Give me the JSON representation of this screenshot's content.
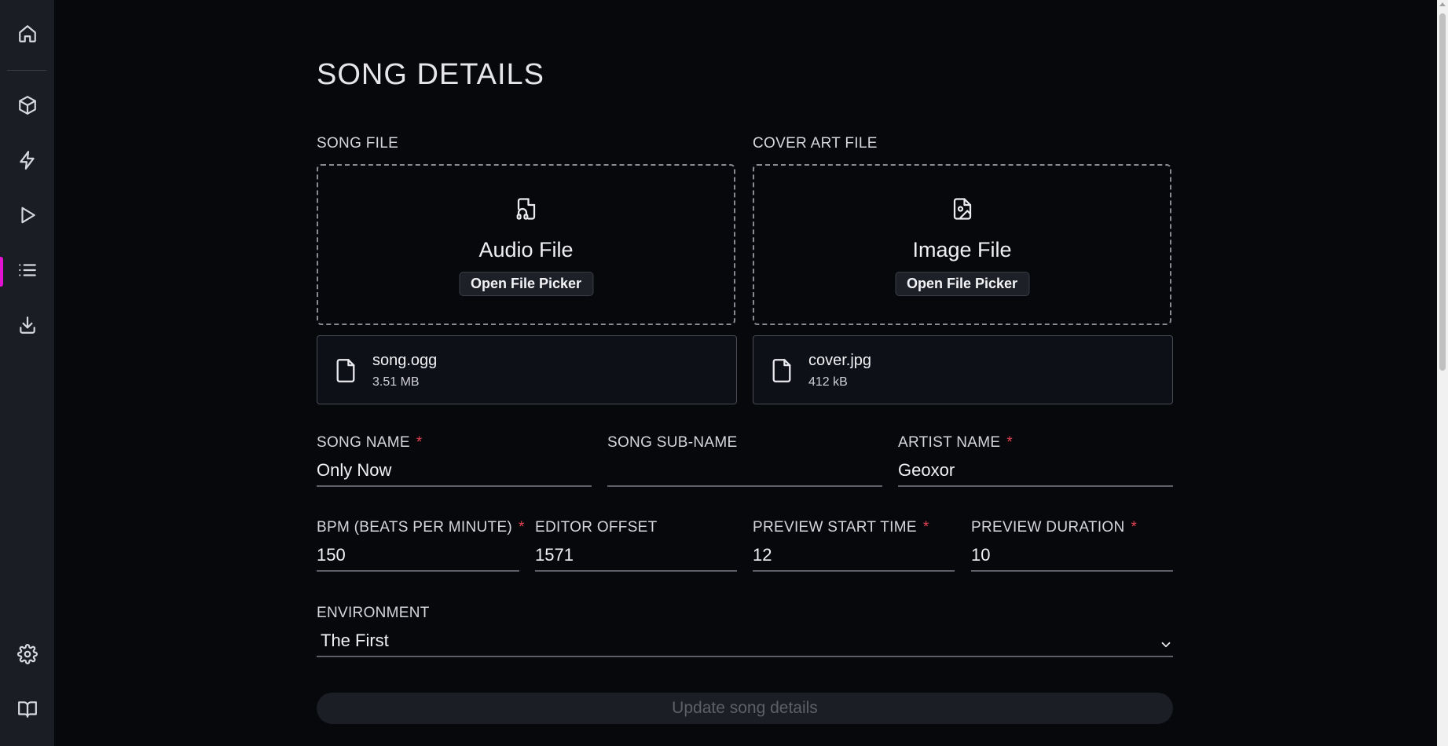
{
  "sidebar": {
    "items": [
      {
        "icon": "home-icon"
      },
      {
        "icon": "cube-icon"
      },
      {
        "icon": "lightning-icon"
      },
      {
        "icon": "play-icon"
      },
      {
        "icon": "list-icon",
        "active": true
      },
      {
        "icon": "download-icon"
      },
      {
        "icon": "settings-icon"
      },
      {
        "icon": "book-icon"
      }
    ],
    "accent_color": "#e112d0"
  },
  "page": {
    "title": "SONG DETAILS"
  },
  "song_file": {
    "label": "SONG FILE",
    "dropzone_icon": "audio-file-icon",
    "dropzone_title": "Audio File",
    "picker_label": "Open File Picker",
    "file_name": "song.ogg",
    "file_size": "3.51 MB"
  },
  "cover_file": {
    "label": "COVER ART FILE",
    "dropzone_icon": "image-file-icon",
    "dropzone_title": "Image File",
    "picker_label": "Open File Picker",
    "file_name": "cover.jpg",
    "file_size": "412 kB"
  },
  "fields": {
    "song_name": {
      "label": "SONG NAME",
      "value": "Only Now",
      "required": true
    },
    "song_sub_name": {
      "label": "SONG SUB-NAME",
      "value": "",
      "required": false
    },
    "artist_name": {
      "label": "ARTIST NAME",
      "value": "Geoxor",
      "required": true
    },
    "bpm": {
      "label": "BPM (BEATS PER MINUTE)",
      "value": "150",
      "required": true
    },
    "editor_offset": {
      "label": "EDITOR OFFSET",
      "value": "1571",
      "required": false
    },
    "preview_start": {
      "label": "PREVIEW START TIME",
      "value": "12",
      "required": true
    },
    "preview_duration": {
      "label": "PREVIEW DURATION",
      "value": "10",
      "required": true
    },
    "environment": {
      "label": "ENVIRONMENT",
      "value": "The First"
    }
  },
  "required_marker": "*",
  "required_color": "#e4434f",
  "submit_label": "Update song details"
}
